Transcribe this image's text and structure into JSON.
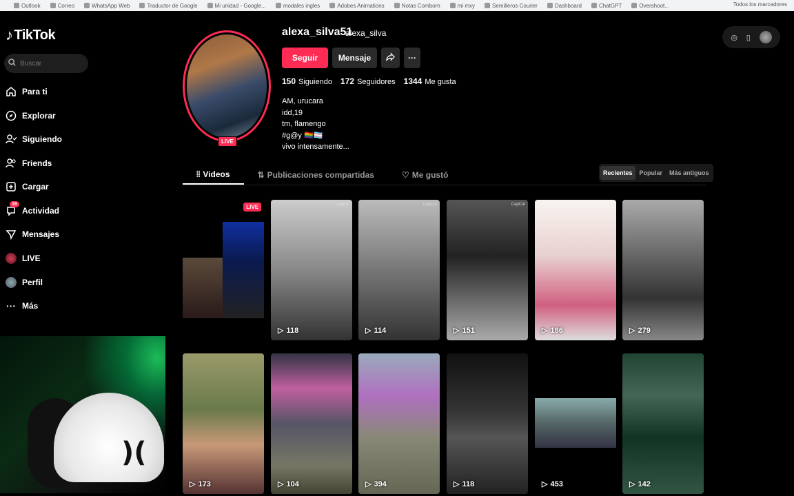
{
  "bookmarks": [
    "Outlook",
    "Correo",
    "WhatsApp Web",
    "Traductor de Google",
    "Mi unidad - Google...",
    "modales ingles",
    "Adobes Animations",
    "Notas Comborn",
    "mi mxy",
    "Semilleros Courier",
    "Dashboard",
    "ChatGPT",
    "Overshoot..."
  ],
  "bookmarks_right": "Todos los marcadores",
  "brand": {
    "name": "TikTok"
  },
  "search": {
    "placeholder": "Buscar"
  },
  "nav": [
    {
      "label": "Para ti",
      "icon": "home-icon"
    },
    {
      "label": "Explorar",
      "icon": "compass-icon"
    },
    {
      "label": "Siguiendo",
      "icon": "following-icon"
    },
    {
      "label": "Friends",
      "icon": "friends-icon"
    },
    {
      "label": "Cargar",
      "icon": "upload-icon"
    },
    {
      "label": "Actividad",
      "icon": "activity-icon",
      "badge": "16"
    },
    {
      "label": "Mensajes",
      "icon": "messages-icon"
    },
    {
      "label": "LIVE",
      "icon": "live-avatar-icon"
    },
    {
      "label": "Perfil",
      "icon": "profile-avatar-icon"
    },
    {
      "label": "Más",
      "icon": "more-icon"
    }
  ],
  "profile": {
    "username": "alexa_silva51",
    "nickname": "alexa_silva",
    "live_label": "LIVE",
    "follow_label": "Seguir",
    "message_label": "Mensaje",
    "stats": {
      "following_count": "150",
      "following_label": "Siguiendo",
      "followers_count": "172",
      "followers_label": "Seguidores",
      "likes_count": "1344",
      "likes_label": "Me gusta"
    },
    "bio": [
      "AM, urucara",
      "idd,19",
      "tm, flamengo",
      "#g@y 🏳️‍🌈🏳️‍⚧️",
      "vivo intensamente..."
    ]
  },
  "tabs": {
    "videos": "Videos",
    "reposts": "Publicaciones compartidas",
    "liked": "Me gustó"
  },
  "sort": {
    "recent": "Recientes",
    "popular": "Popular",
    "oldest": "Más antiguos"
  },
  "videos": [
    {
      "views": "",
      "live": "LIVE"
    },
    {
      "views": "118"
    },
    {
      "views": "114"
    },
    {
      "views": "151"
    },
    {
      "views": "186"
    },
    {
      "views": "279"
    },
    {
      "views": "173"
    },
    {
      "views": "104"
    },
    {
      "views": "394"
    },
    {
      "views": "118"
    },
    {
      "views": "453"
    },
    {
      "views": "142"
    }
  ],
  "capcut_label": "CapCut",
  "colors": {
    "accent": "#fe2c55",
    "background": "#000000",
    "surface": "#2a2a2a"
  }
}
